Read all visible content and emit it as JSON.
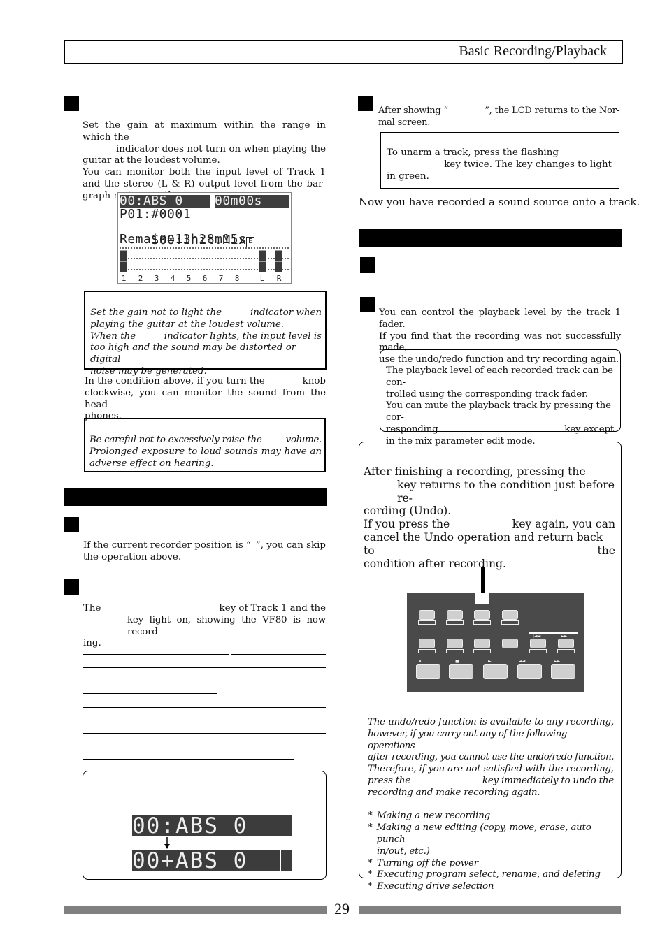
{
  "header": {
    "title": "Basic Recording/Playback"
  },
  "left_column": {
    "gain_paragraph_1_line1": "Set the gain at maximum within the range in which the",
    "gain_paragraph_1_line2": "indicator does not turn on when playing the",
    "gain_paragraph_1_line3": "guitar at the loudest volume.",
    "gain_paragraph_2": "You can monitor both the input level of Track 1 and the stereo (L & R) output level from the bar-graph meters on the screen.",
    "lcd": {
      "line1_left": "00:ABS 0",
      "line1_right": "00m00s",
      "line2": "P01:#0001",
      "line3": "S00:Init.Mix",
      "line3_icon": "E",
      "line4": "Remain=13h28m15s",
      "meter_labels": [
        "1",
        "2",
        "3",
        "4",
        "5",
        "6",
        "7",
        "8",
        "L",
        "R"
      ],
      "meter_levels": [
        1.0,
        0,
        0,
        0,
        0,
        0,
        0,
        0,
        1.0,
        1.0
      ]
    },
    "note_gain": {
      "line1a": "Set the gain not to light the",
      "line1b": "indicator when",
      "line2": "playing the guitar at the loudest volume.",
      "line3a": "When the",
      "line3b": "indicator lights, the input level is",
      "line4": "too high and the sound may be distorted or digital",
      "line5": "noise may be generated."
    },
    "phones_paragraph": {
      "line1a": "In the condition above, if you turn the",
      "line1b": "knob",
      "line2": "clockwise, you can monitor the sound from the head-",
      "line3": "phones."
    },
    "caution": {
      "line1a": "Be careful not to excessively raise the",
      "line1b": "volume.",
      "line2": "Prolonged exposure to loud sounds may have an",
      "line3": "adverse effect on hearing."
    },
    "skip_paragraph": {
      "line1a": "If the current recorder position is “",
      "line1b": "”, you can skip",
      "line2": "the operation above."
    },
    "recording_paragraph": {
      "line1a": "The",
      "line1b": "key of Track 1 and the",
      "line2": "key light on, showing the VF80 is now record-",
      "line3": "ing."
    },
    "lcd_change": {
      "before": "00:ABS 0",
      "after": "00+ABS 0",
      "arrow_icon": "down-arrow"
    }
  },
  "right_column": {
    "lcd_return": {
      "line1a": "After showing “",
      "line1b": "”, the LCD returns to the Nor-",
      "line2": "mal screen."
    },
    "unarm_note": {
      "line1": "To unarm a track, press the flashing",
      "line2": "key twice. The key changes to light",
      "line3": "in green."
    },
    "recorded_statement": "Now you have recorded a sound source onto a track.",
    "playback_paragraph": {
      "line1": "You can control the playback level by the track 1 fader.",
      "line2": "If you find that the recording was not successfully made,",
      "line3": "use the undo/redo function and try recording again."
    },
    "playback_note": {
      "line1": "The playback level of each recorded track can be con-",
      "line2": "trolled using the corresponding track fader.",
      "line3": "You can mute the playback track by pressing the cor-",
      "line4a": "responding",
      "line4b": "key except",
      "line5": "in the mix parameter edit mode."
    },
    "undo_box": {
      "line1": "After finishing a recording, pressing the",
      "line2": "key returns to the condition just before re-",
      "line3": "cording (Undo).",
      "line4a": "If you press the",
      "line4b": "key again, you can",
      "line5": "cancel the Undo operation and return back to the",
      "line6": "condition after recording.",
      "note_line1": "The undo/redo function is available to any recording,",
      "note_line2": "however, if you carry out any of the following operations",
      "note_line3": "after recording, you cannot use the undo/redo function.",
      "note_line4": "Therefore, if you are not satisfied with the recording,",
      "note_line5a": "press the",
      "note_line5b": "key immediately to undo the",
      "note_line6": "recording and make recording again.",
      "list": [
        "Making a new recording",
        "Making a new editing (copy, move, erase, auto punch",
        "in/out, etc.)",
        "Turning off the power",
        "Executing program select, rename, and deleting",
        "Executing drive selection"
      ],
      "bullet": "*",
      "transport_symbols": {
        "rec": "•",
        "stop": "■",
        "play": "►",
        "rew": "◄◄",
        "ff": "►►",
        "prev": "|◄◄",
        "next": "►►|"
      }
    }
  },
  "footer": {
    "page_number": "29"
  }
}
